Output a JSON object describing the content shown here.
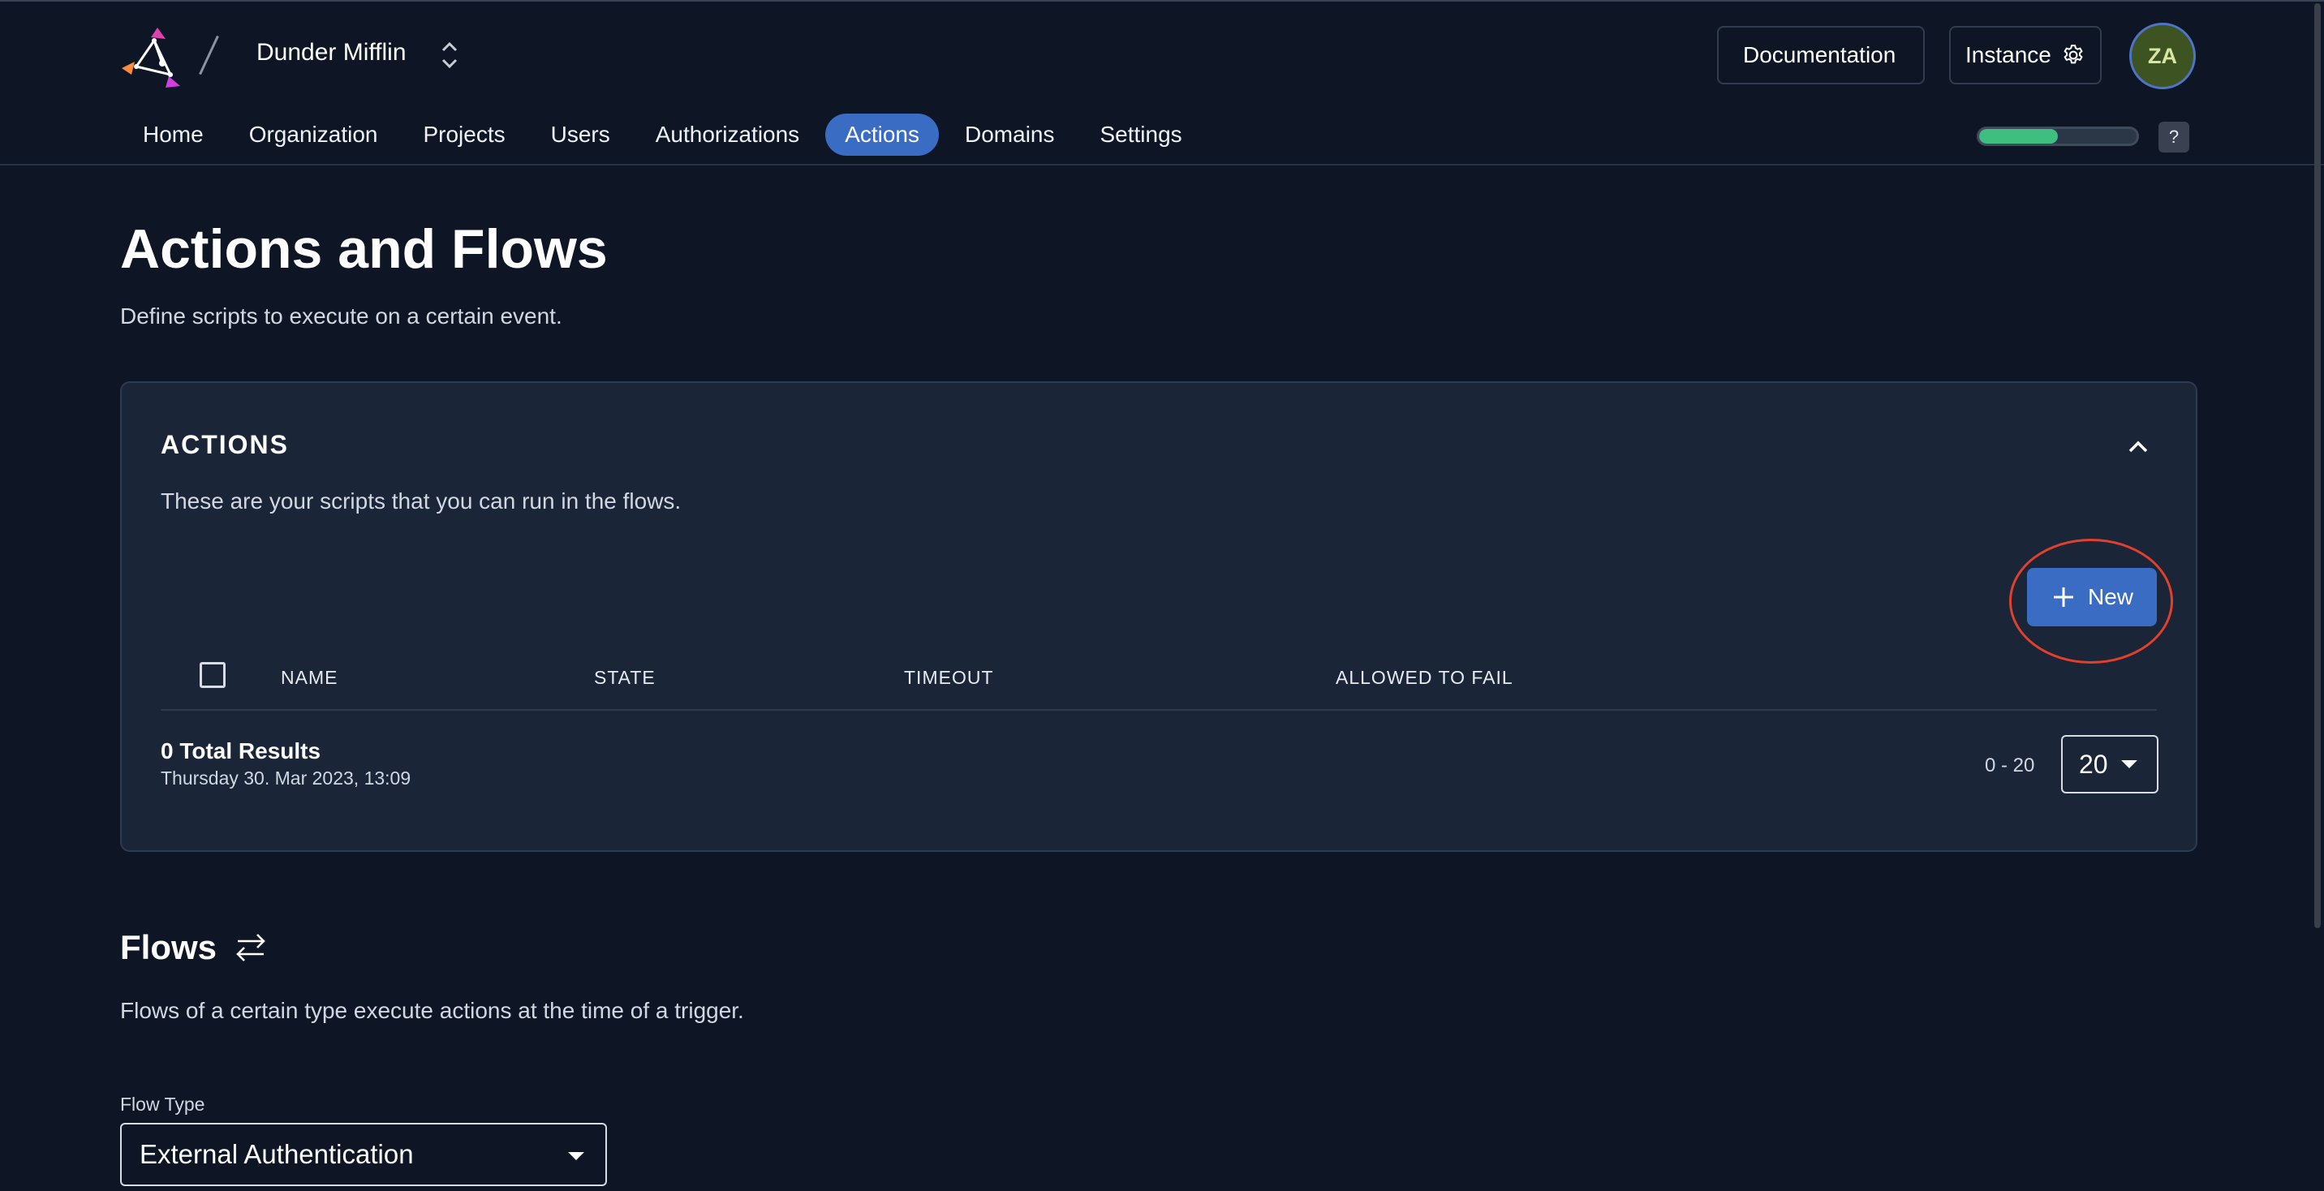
{
  "header": {
    "org_name": "Dunder Mifflin",
    "documentation_label": "Documentation",
    "instance_label": "Instance",
    "avatar_initials": "ZA",
    "progress_fraction": 0.5,
    "help_label": "?"
  },
  "nav": {
    "items": [
      {
        "label": "Home",
        "active": false
      },
      {
        "label": "Organization",
        "active": false
      },
      {
        "label": "Projects",
        "active": false
      },
      {
        "label": "Users",
        "active": false
      },
      {
        "label": "Authorizations",
        "active": false
      },
      {
        "label": "Actions",
        "active": true
      },
      {
        "label": "Domains",
        "active": false
      },
      {
        "label": "Settings",
        "active": false
      }
    ]
  },
  "page": {
    "title": "Actions and Flows",
    "subtitle": "Define scripts to execute on a certain event."
  },
  "actions_card": {
    "title": "ACTIONS",
    "description": "These are your scripts that you can run in the flows.",
    "new_button_label": "New",
    "columns": [
      "NAME",
      "STATE",
      "TIMEOUT",
      "ALLOWED TO FAIL"
    ],
    "total_results": "0 Total Results",
    "timestamp": "Thursday 30. Mar 2023, 13:09",
    "range": "0 - 20",
    "page_size": "20"
  },
  "flows": {
    "title": "Flows",
    "description": "Flows of a certain type execute actions at the time of a trigger.",
    "flow_type_label": "Flow Type",
    "flow_type_value": "External Authentication"
  },
  "colors": {
    "background": "#0e1626",
    "card": "#1b2538",
    "accent": "#3a6cc4",
    "progress": "#3fbf7f",
    "highlight": "#e0402c"
  }
}
